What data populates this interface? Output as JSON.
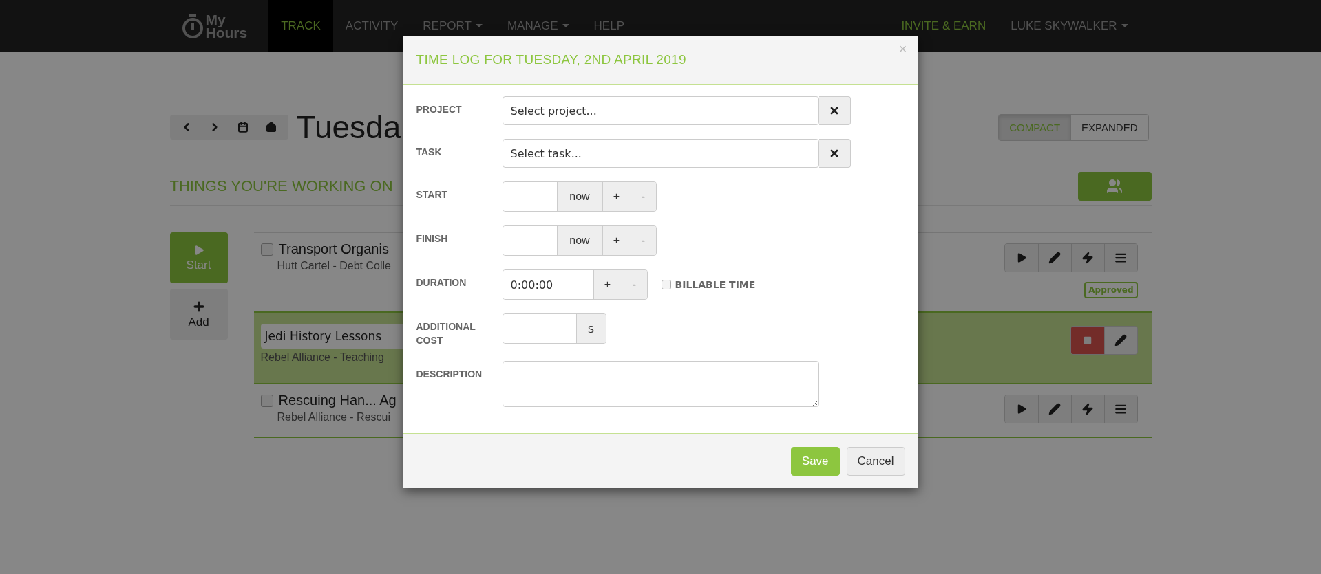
{
  "nav": {
    "logo": {
      "line_1": "My",
      "line_2": "Hours"
    },
    "items": [
      {
        "label": "TRACK",
        "selected": true,
        "dropdown": false
      },
      {
        "label": "ACTIVITY",
        "selected": false,
        "dropdown": false
      },
      {
        "label": "REPORT",
        "selected": false,
        "dropdown": true
      },
      {
        "label": "MANAGE",
        "selected": false,
        "dropdown": true
      },
      {
        "label": "HELP",
        "selected": false,
        "dropdown": false
      }
    ],
    "right": [
      {
        "label": "INVITE & EARN",
        "kind": "invite"
      },
      {
        "label": "LUKE SKYWALKER",
        "kind": "user"
      }
    ]
  },
  "day_title": "Tuesda",
  "view_toggle": [
    {
      "label": "COMPACT",
      "selected": true
    },
    {
      "label": "EXPANDED",
      "selected": false
    }
  ],
  "section_title": "THINGS YOU'RE WORKING ON",
  "side_buttons": [
    {
      "label": "Start",
      "kind": "start"
    },
    {
      "label": "Add",
      "kind": "add"
    }
  ],
  "entries": [
    {
      "kind": "idle",
      "title": "Transport Organis",
      "subtitle": "Hutt Cartel - Debt Colle",
      "checked": false,
      "status": "Approved"
    },
    {
      "kind": "running",
      "title": "Jedi History Lessons",
      "subtitle": "Rebel Alliance - Teaching"
    },
    {
      "kind": "idle",
      "title": "Rescuing Han... Ag",
      "subtitle": "Rebel Alliance - Rescui",
      "checked": false
    }
  ],
  "modal": {
    "title": "TIME LOG FOR TUESDAY, 2ND APRIL 2019",
    "close": "×",
    "fields": [
      {
        "kind": "select",
        "label": "PROJECT",
        "placeholder": "Select project..."
      },
      {
        "kind": "select",
        "label": "TASK",
        "placeholder": "Select task..."
      },
      {
        "kind": "time",
        "label": "START",
        "now": "now",
        "plus": "+",
        "minus": "-"
      },
      {
        "kind": "time",
        "label": "FINISH",
        "now": "now",
        "plus": "+",
        "minus": "-"
      },
      {
        "kind": "duration",
        "label": "DURATION",
        "value": "0:00:00",
        "plus": "+",
        "minus": "-",
        "billable": {
          "label": "BILLABLE TIME",
          "checked": false
        }
      },
      {
        "kind": "cost",
        "label": "ADDITIONAL COST",
        "addon": "$"
      },
      {
        "kind": "textarea",
        "label": "DESCRIPTION"
      }
    ],
    "buttons": [
      {
        "label": "Save",
        "kind": "primary"
      },
      {
        "label": "Cancel",
        "kind": "default"
      }
    ]
  }
}
